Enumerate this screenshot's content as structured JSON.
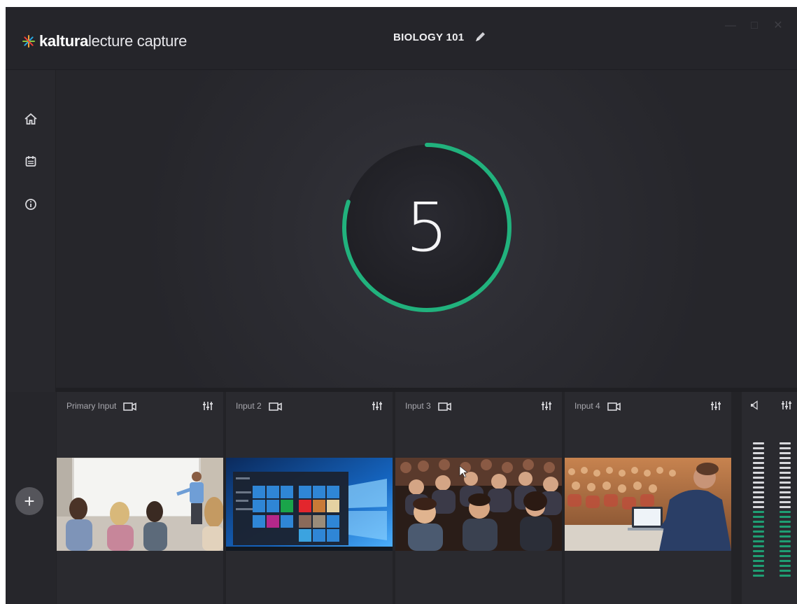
{
  "app": {
    "logo_bold": "kaltura",
    "logo_light": "lecture capture",
    "course_title": "BIOLOGY 101",
    "window_controls": [
      "—",
      "□",
      "✕"
    ]
  },
  "sidebar": {
    "items": [
      {
        "name": "home-icon"
      },
      {
        "name": "calendar-icon"
      },
      {
        "name": "info-icon"
      }
    ]
  },
  "countdown": {
    "value": "5",
    "progress": 0.8,
    "accent_color": "#21b27d"
  },
  "inputs": [
    {
      "label": "Primary Input",
      "scene": "classroom"
    },
    {
      "label": "Input 2",
      "scene": "desktop"
    },
    {
      "label": "Input 3",
      "scene": "audience"
    },
    {
      "label": "Input 4",
      "scene": "lecture-hall"
    }
  ],
  "audio": {
    "meter_segments": 28,
    "active_segments": 14,
    "active_color": "#1f9e73",
    "inactive_color": "#d8d8dc"
  },
  "colors": {
    "background": "#26262b",
    "panel": "#2a2a2f",
    "accent": "#21b27d"
  }
}
